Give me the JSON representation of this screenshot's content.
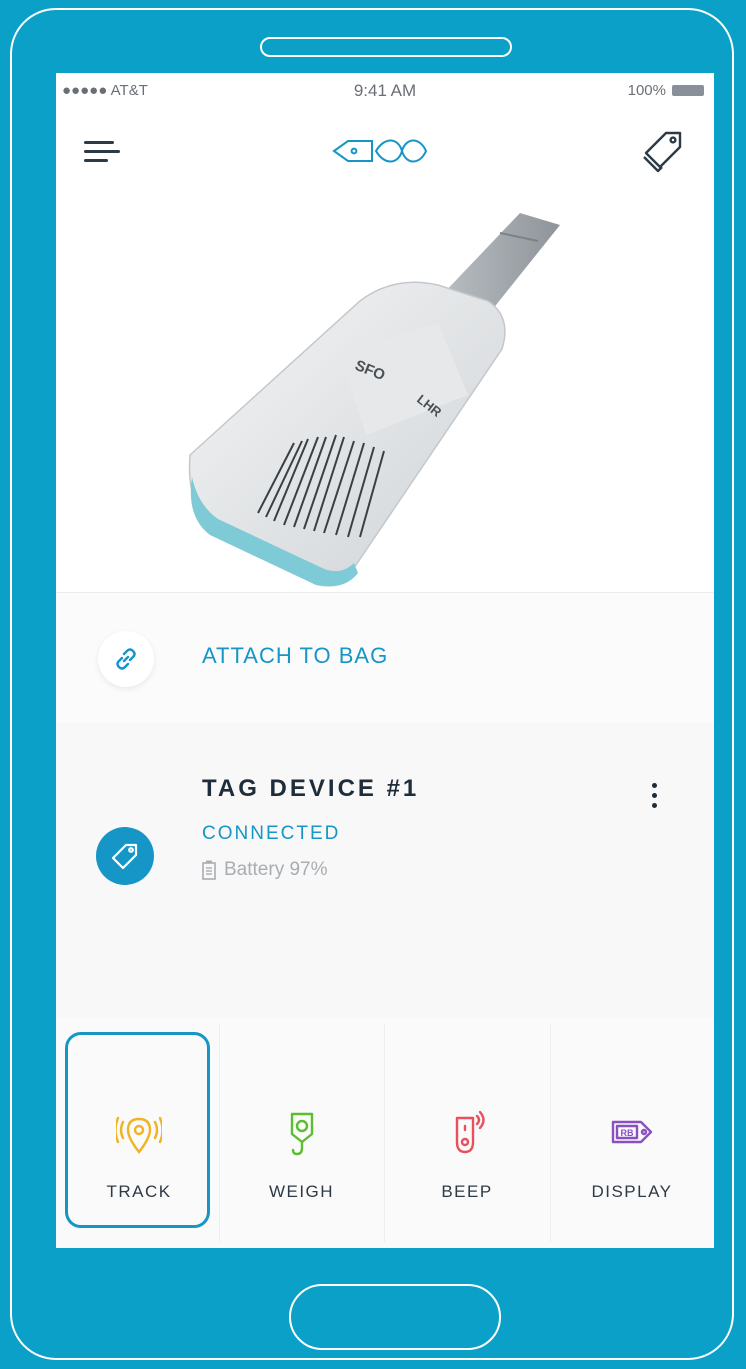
{
  "status_bar": {
    "carrier": "●●●●● AT&T",
    "time": "9:41 AM",
    "battery": "100%"
  },
  "nav": {
    "menu_icon": "menu-icon",
    "logo_icon": "tag-infinity-logo",
    "tags_icon": "tags-icon"
  },
  "hero": {
    "origin": "SFO",
    "destination": "LHR"
  },
  "attach": {
    "label": "ATTACH TO BAG",
    "icon": "link-icon"
  },
  "device": {
    "name": "TAG DEVICE #1",
    "status": "CONNECTED",
    "battery": "Battery 97%",
    "icon": "tag-icon",
    "more_icon": "more-vertical-icon"
  },
  "actions": [
    {
      "label": "TRACK",
      "icon": "location-pin-icon",
      "color": "#f0b323",
      "selected": true
    },
    {
      "label": "WEIGH",
      "icon": "scale-hook-icon",
      "color": "#5bbd2f",
      "selected": false
    },
    {
      "label": "BEEP",
      "icon": "beep-tag-icon",
      "color": "#e8505b",
      "selected": false
    },
    {
      "label": "DISPLAY",
      "icon": "display-tag-icon",
      "color": "#8b4fc4",
      "selected": false
    }
  ],
  "colors": {
    "background": "#0aa0c8",
    "accent": "#1596c6"
  }
}
